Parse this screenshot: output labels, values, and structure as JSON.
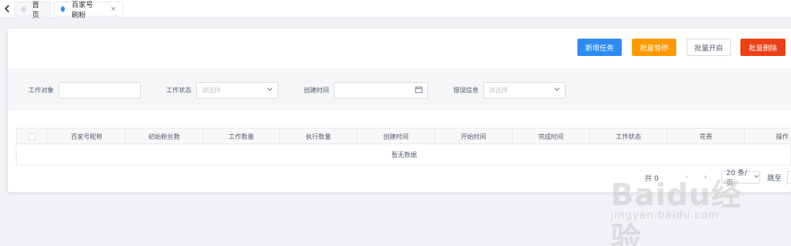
{
  "tabs": [
    {
      "label": "首页"
    },
    {
      "label": "百家号刷粉",
      "close": "×"
    }
  ],
  "toolbar": {
    "add_label": "新增任务",
    "pause_label": "批量暂停",
    "open_label": "批量开启",
    "delete_label": "批量删除",
    "colors": {
      "primary": "#2d8cf0",
      "warning": "#ff9900",
      "danger": "#ed4014"
    }
  },
  "filters": {
    "target_label": "工作对象",
    "target_value": "",
    "status_label": "工作状态",
    "status_placeholder": "请选择",
    "created_label": "创建时间",
    "created_value": "",
    "error_label": "错误信息",
    "error_placeholder": "请选择"
  },
  "table": {
    "columns": [
      "百家号昵称",
      "初始粉丝数",
      "工作数量",
      "执行数量",
      "创建时间",
      "开始时间",
      "完成时间",
      "工作状态",
      "花费",
      "操作"
    ],
    "empty_text": "暂无数据"
  },
  "pagination": {
    "total_text": "共 0",
    "prev": "‹",
    "next": "›",
    "page_size": "20 条/页",
    "jump_label": "跳至"
  },
  "watermark": {
    "text": "Baidu经验",
    "sub": "jingyan.baidu.com"
  }
}
